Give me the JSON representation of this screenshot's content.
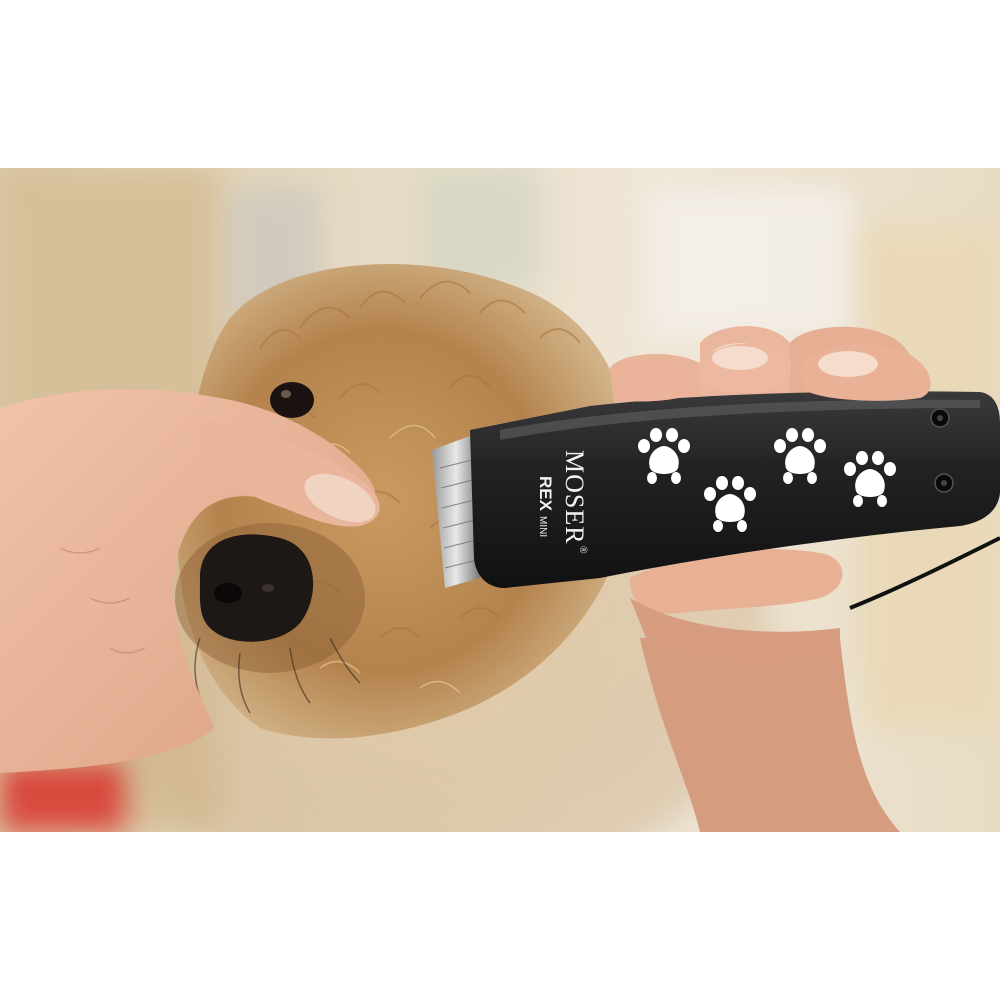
{
  "photo": {
    "subject": "dog grooming with clipper",
    "clipper": {
      "brand": "MOSER",
      "registered_mark": "®",
      "model_primary": "REX",
      "model_secondary": "MINI",
      "body_color": "#1c1c1e",
      "paw_print_color": "#ffffff",
      "paw_prints_count": 4
    },
    "colors": {
      "page_background": "#ffffff",
      "backdrop_warm": "#dcc9a6",
      "backdrop_light": "#efe6d6",
      "fur_main": "#b98a52",
      "fur_light": "#d8b88a",
      "skin": "#e8b49a",
      "table_red": "#d8493d"
    }
  }
}
